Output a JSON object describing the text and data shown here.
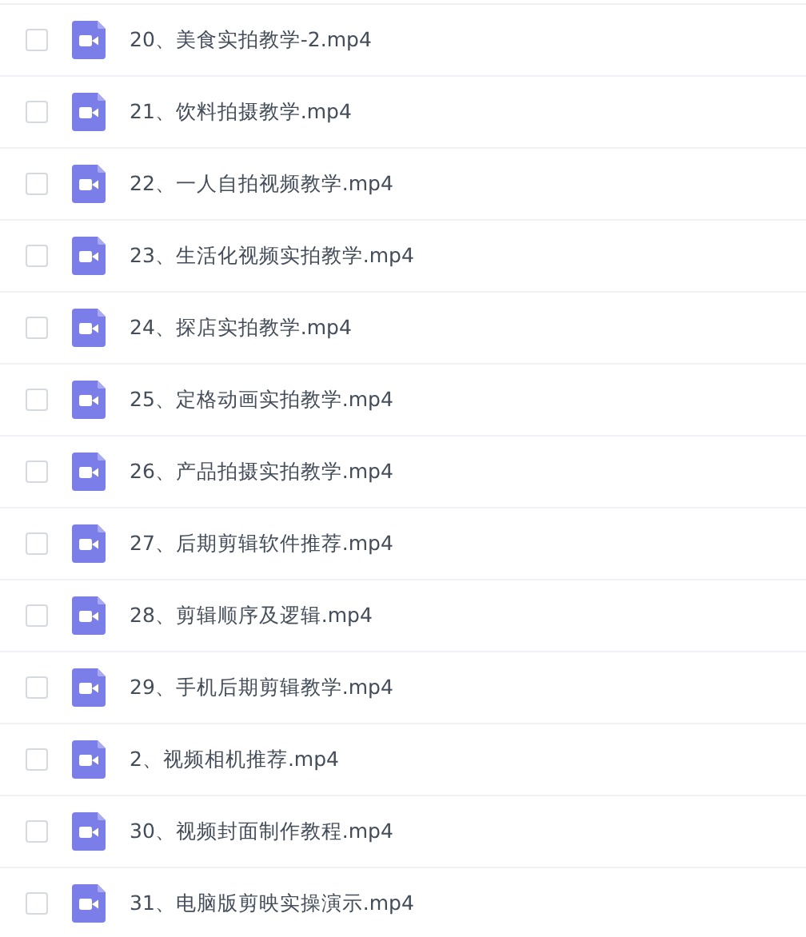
{
  "files": [
    {
      "name": "20、美食实拍教学-2.mp4",
      "checked": false
    },
    {
      "name": "21、饮料拍摄教学.mp4",
      "checked": false
    },
    {
      "name": "22、一人自拍视频教学.mp4",
      "checked": false
    },
    {
      "name": "23、生活化视频实拍教学.mp4",
      "checked": false
    },
    {
      "name": "24、探店实拍教学.mp4",
      "checked": false
    },
    {
      "name": "25、定格动画实拍教学.mp4",
      "checked": false
    },
    {
      "name": "26、产品拍摄实拍教学.mp4",
      "checked": false
    },
    {
      "name": "27、后期剪辑软件推荐.mp4",
      "checked": false
    },
    {
      "name": "28、剪辑顺序及逻辑.mp4",
      "checked": false
    },
    {
      "name": "29、手机后期剪辑教学.mp4",
      "checked": false
    },
    {
      "name": "2、视频相机推荐.mp4",
      "checked": false
    },
    {
      "name": "30、视频封面制作教程.mp4",
      "checked": false
    },
    {
      "name": "31、电脑版剪映实操演示.mp4",
      "checked": false
    }
  ]
}
